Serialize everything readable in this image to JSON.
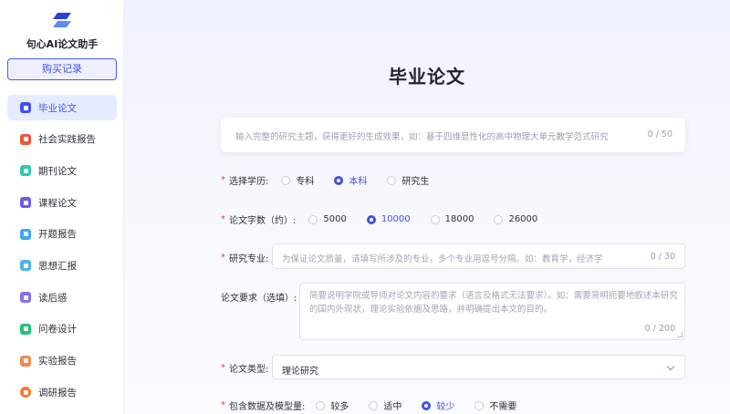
{
  "app": {
    "brand": "句心AI论文助手",
    "buy_label": "购买记录"
  },
  "sidebar": {
    "items": [
      {
        "label": "毕业论文",
        "icon": "thesis-icon",
        "color": "#3f51e8",
        "active": true
      },
      {
        "label": "社会实践报告",
        "icon": "practice-report-icon",
        "color": "#f0533f",
        "active": false
      },
      {
        "label": "期刊论文",
        "icon": "journal-icon",
        "color": "#2fc6b6",
        "active": false
      },
      {
        "label": "课程论文",
        "icon": "course-paper-icon",
        "color": "#6a5cf0",
        "active": false
      },
      {
        "label": "开题报告",
        "icon": "proposal-icon",
        "color": "#3aa8f0",
        "active": false
      },
      {
        "label": "思想汇报",
        "icon": "thought-report-icon",
        "color": "#4fb3e8",
        "active": false
      },
      {
        "label": "读后感",
        "icon": "reading-note-icon",
        "color": "#8a6cf0",
        "active": false
      },
      {
        "label": "问卷设计",
        "icon": "questionnaire-icon",
        "color": "#22c27a",
        "active": false
      },
      {
        "label": "实验报告",
        "icon": "experiment-report-icon",
        "color": "#f08a4f",
        "active": false
      },
      {
        "label": "调研报告",
        "icon": "research-report-icon",
        "color": "#f07a2a",
        "active": false
      }
    ]
  },
  "main": {
    "title": "毕业论文",
    "topic": {
      "placeholder": "输入完整的研究主题，获得更好的生成效果，如：基于四维显性化的高中物理大单元教学范式研究",
      "counter": "0 / 50"
    },
    "education": {
      "label": "选择学历:",
      "options": [
        "专科",
        "本科",
        "研究生"
      ],
      "selected": "本科"
    },
    "word_count": {
      "label": "论文字数（约）:",
      "options": [
        "5000",
        "10000",
        "18000",
        "26000"
      ],
      "selected": "10000"
    },
    "major": {
      "label": "研究专业:",
      "placeholder": "为保证论文质量，请填写所涉及的专业，多个专业用逗号分隔。如：教育学，经济学",
      "counter": "0 / 30"
    },
    "requirements": {
      "label": "论文要求（选填）:",
      "placeholder": "简要说明学院或导师对论文内容的要求（语言及格式无法要求）。如：需要简明扼要地叙述本研究的国内外现状，理论实验依据及思路，并明确提出本文的目的。",
      "counter": "0 / 200"
    },
    "paper_type": {
      "label": "论文类型:",
      "value": "理论研究"
    },
    "data_model": {
      "label": "包含数据及模型量:",
      "options": [
        "较多",
        "适中",
        "较少",
        "不需要"
      ],
      "selected": "较少"
    }
  },
  "colors": {
    "accent": "#3f51e8",
    "required": "#e03a3a"
  }
}
